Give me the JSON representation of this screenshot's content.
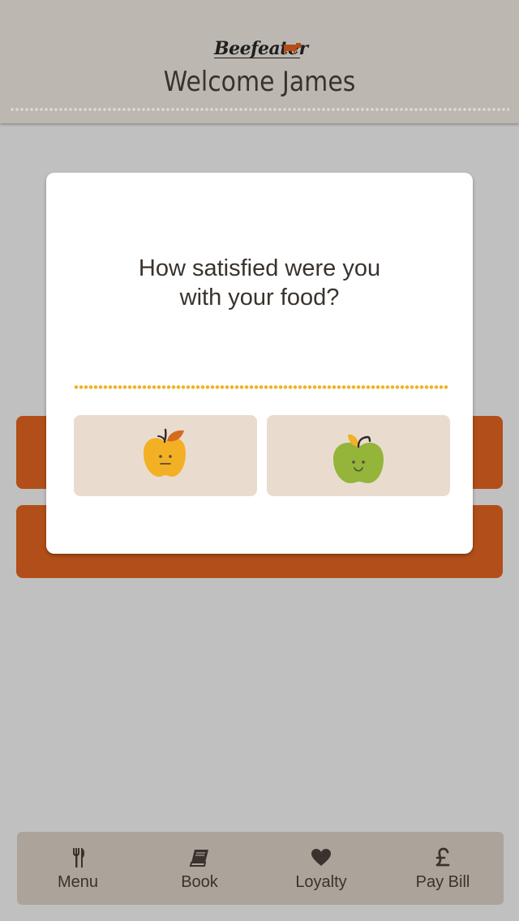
{
  "header": {
    "brand": "Beefeater",
    "title": "Welcome James"
  },
  "background_buttons": [
    {
      "color": "#b14e19"
    },
    {
      "color": "#b14e19"
    }
  ],
  "modal": {
    "question": "How satisfied were you\nwith your food?",
    "options": [
      {
        "icon": "neutral-apple-icon",
        "color": "#f4b024"
      },
      {
        "icon": "happy-apple-icon",
        "color": "#94b43a"
      }
    ]
  },
  "tabbar": {
    "tabs": [
      {
        "label": "Menu",
        "icon": "fork-knife-icon"
      },
      {
        "label": "Book",
        "icon": "book-icon"
      },
      {
        "label": "Loyalty",
        "icon": "heart-icon"
      },
      {
        "label": "Pay Bill",
        "icon": "pound-icon"
      }
    ]
  },
  "colors": {
    "accent": "#b14e19",
    "dots": "#f0b323",
    "header_bg": "#bcb8b1"
  }
}
